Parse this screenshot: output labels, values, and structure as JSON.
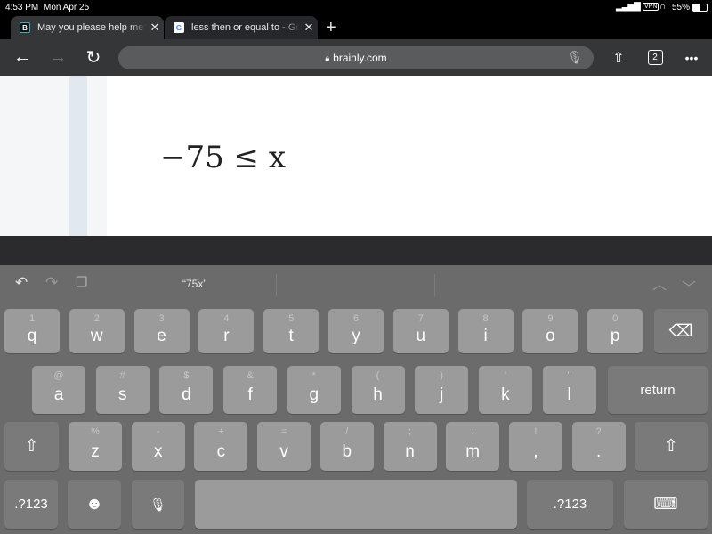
{
  "status": {
    "time": "4:53 PM",
    "date": "Mon Apr 25",
    "vpn": "VPN",
    "battery": "55%"
  },
  "tabs": [
    {
      "favicon": "B",
      "title": "May you please help me?",
      "active": true
    },
    {
      "favicon": "G",
      "title": "less then or equal to - Google",
      "active": false
    }
  ],
  "toolbar": {
    "url": "brainly.com",
    "tab_count": "2"
  },
  "content": {
    "math": "−75 ≤ x"
  },
  "keyboard": {
    "suggestion": "“75x”",
    "row1": [
      [
        "q",
        "1"
      ],
      [
        "w",
        "2"
      ],
      [
        "e",
        "3"
      ],
      [
        "r",
        "4"
      ],
      [
        "t",
        "5"
      ],
      [
        "y",
        "6"
      ],
      [
        "u",
        "7"
      ],
      [
        "i",
        "8"
      ],
      [
        "o",
        "9"
      ],
      [
        "p",
        "0"
      ]
    ],
    "row2": [
      [
        "a",
        "@"
      ],
      [
        "s",
        "#"
      ],
      [
        "d",
        "$"
      ],
      [
        "f",
        "&"
      ],
      [
        "g",
        "*"
      ],
      [
        "h",
        "("
      ],
      [
        "j",
        ")"
      ],
      [
        "k",
        "'"
      ],
      [
        "l",
        "\""
      ]
    ],
    "row3": [
      [
        "z",
        "%"
      ],
      [
        "x",
        "-"
      ],
      [
        "c",
        "+"
      ],
      [
        "v",
        "="
      ],
      [
        "b",
        "/"
      ],
      [
        "n",
        ";"
      ],
      [
        "m",
        ":"
      ],
      [
        ",",
        "!"
      ],
      [
        ".",
        "?"
      ]
    ],
    "return": "return",
    "numbers": ".?123"
  }
}
